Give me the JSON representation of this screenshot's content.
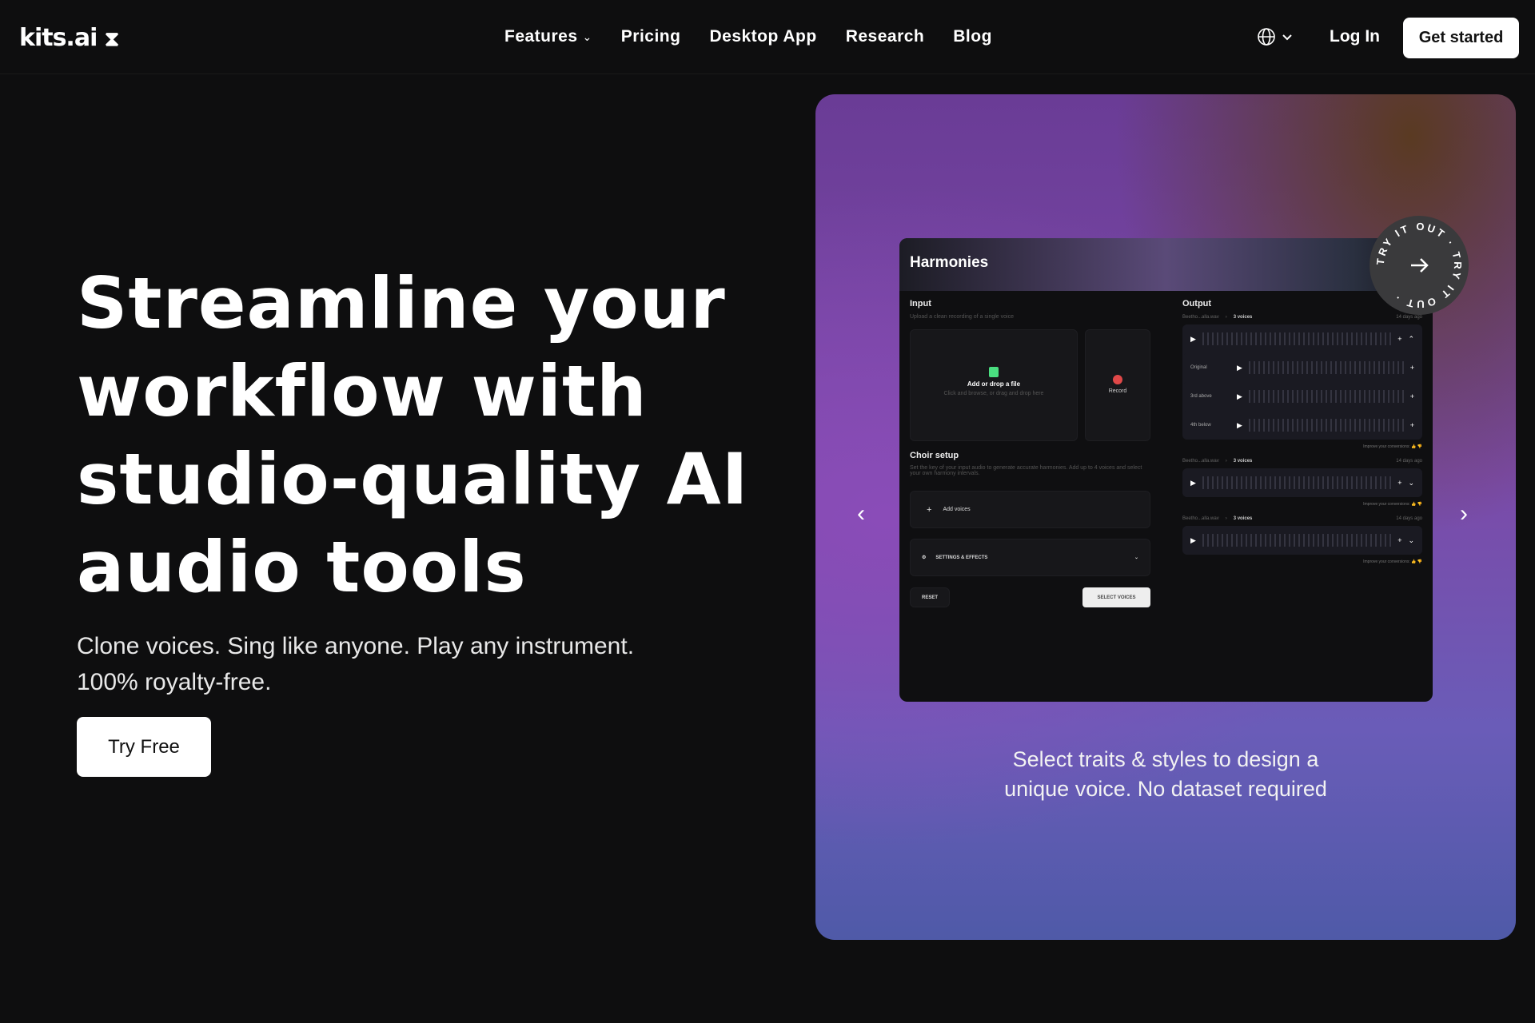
{
  "nav": {
    "logo": "kits.ai",
    "items": [
      "Features",
      "Pricing",
      "Desktop App",
      "Research",
      "Blog"
    ],
    "login": "Log In",
    "cta": "Get started",
    "icons": {
      "features": "chevron-down-icon",
      "language": "globe-icon"
    }
  },
  "hero": {
    "title": "Streamline your workflow with studio-quality AI audio tools",
    "subtitle_line1": "Clone voices. Sing like anyone. Play any instrument.",
    "subtitle_line2": "100% royalty-free.",
    "cta": "Try Free"
  },
  "showcase": {
    "caption_line1": "Select traits & styles to design a",
    "caption_line2": "unique voice. No dataset required",
    "badge": "TRY IT OUT · TRY IT OUT ·",
    "colors": {
      "accent": "#7b4aa8",
      "record": "#e04848",
      "upload": "#4ade80"
    },
    "app": {
      "title": "Harmonies",
      "input_label": "Input",
      "input_hint": "Upload a clean recording of a single voice",
      "upload_title": "Add or drop a file",
      "upload_hint": "Click and browse, or drag and drop here",
      "record": "Record",
      "choir_label": "Choir setup",
      "choir_hint": "Set the key of your input audio to generate accurate harmonies. Add up to 4 voices and select your own harmony intervals.",
      "add_voices": "Add voices",
      "settings": "SETTINGS & EFFECTS",
      "reset": "RESET",
      "select_voices": "SELECT VOICES",
      "output_label": "Output",
      "outputs": [
        {
          "file": "Beetho...alla.wav",
          "voices": "3 voices",
          "time": "14 days ago",
          "tracks": [
            "Original",
            "3rd above",
            "4th below"
          ]
        },
        {
          "file": "Beetho...alla.wav",
          "voices": "3 voices",
          "time": "14 days ago"
        },
        {
          "file": "Beetho...alla.wav",
          "voices": "3 voices",
          "time": "14 days ago"
        }
      ],
      "feedback": "Improve your conversions:"
    }
  }
}
